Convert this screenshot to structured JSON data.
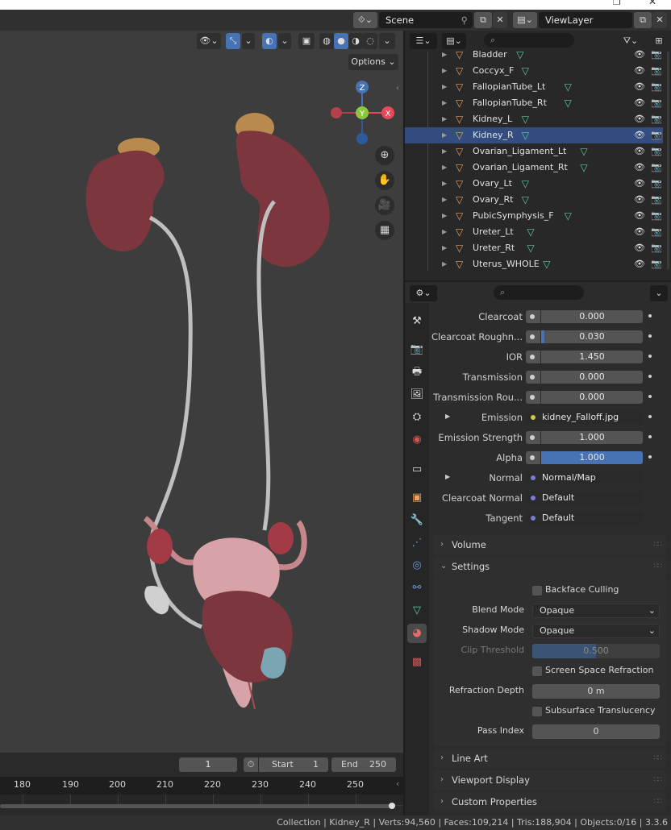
{
  "topbar": {
    "scene_label": "Scene",
    "viewlayer_label": "ViewLayer"
  },
  "viewport": {
    "options_label": "Options",
    "gizmo": {
      "z": "Z",
      "y": "Y",
      "x": "X"
    }
  },
  "timeline": {
    "current_frame": "1",
    "start_label": "Start",
    "start_value": "1",
    "end_label": "End",
    "end_value": "250",
    "ruler": [
      "180",
      "190",
      "200",
      "210",
      "220",
      "230",
      "240",
      "250"
    ]
  },
  "outliner": {
    "items": [
      {
        "name": "Bladder"
      },
      {
        "name": "Coccyx_F"
      },
      {
        "name": "FallopianTube_Lt"
      },
      {
        "name": "FallopianTube_Rt"
      },
      {
        "name": "Kidney_L"
      },
      {
        "name": "Kidney_R"
      },
      {
        "name": "Ovarian_Ligament_Lt"
      },
      {
        "name": "Ovarian_Ligament_Rt"
      },
      {
        "name": "Ovary_Lt"
      },
      {
        "name": "Ovary_Rt"
      },
      {
        "name": "PubicSymphysis_F"
      },
      {
        "name": "Ureter_Lt"
      },
      {
        "name": "Ureter_Rt"
      },
      {
        "name": "Uterus_WHOLE"
      }
    ]
  },
  "properties": {
    "rows": [
      {
        "label": "Clearcoat",
        "value": "0.000"
      },
      {
        "label": "Clearcoat Roughn...",
        "value": "0.030",
        "fill": 0.03
      },
      {
        "label": "IOR",
        "value": "1.450"
      },
      {
        "label": "Transmission",
        "value": "0.000"
      },
      {
        "label": "Transmission Rou...",
        "value": "0.000"
      },
      {
        "label": "Emission",
        "value": "kidney_Falloff.jpg"
      },
      {
        "label": "Emission Strength",
        "value": "1.000"
      },
      {
        "label": "Alpha",
        "value": "1.000",
        "fill": 1.0
      },
      {
        "label": "Normal",
        "value": "Normal/Map"
      },
      {
        "label": "Clearcoat Normal",
        "value": "Default"
      },
      {
        "label": "Tangent",
        "value": "Default"
      }
    ],
    "sections": {
      "volume": "Volume",
      "settings": "Settings",
      "line_art": "Line Art",
      "viewport_display": "Viewport Display",
      "custom_properties": "Custom Properties"
    },
    "settings": {
      "backface_culling": "Backface Culling",
      "blend_mode_label": "Blend Mode",
      "blend_mode_value": "Opaque",
      "shadow_mode_label": "Shadow Mode",
      "shadow_mode_value": "Opaque",
      "clip_threshold_label": "Clip Threshold",
      "clip_threshold_value": "0.500",
      "clip_threshold_fill": 0.5,
      "screen_space_refraction": "Screen Space Refraction",
      "refraction_depth_label": "Refraction Depth",
      "refraction_depth_value": "0 m",
      "subsurface_translucency": "Subsurface Translucency",
      "pass_index_label": "Pass Index",
      "pass_index_value": "0"
    }
  },
  "statusbar": {
    "text": "Collection | Kidney_R | Verts:94,560 | Faces:109,214 | Tris:188,904 | Objects:0/16 | 3.3.6"
  },
  "colors": {
    "accent_blue": "#4772b3",
    "object_orange": "#e8a25b",
    "mesh_green": "#63cc9c"
  }
}
